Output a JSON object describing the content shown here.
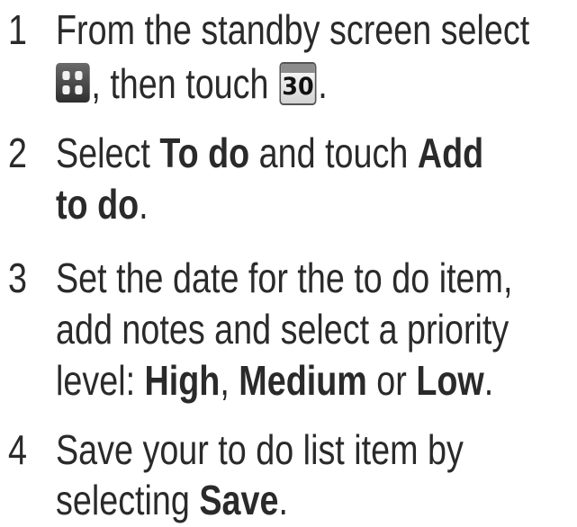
{
  "steps": [
    {
      "number": "1",
      "line1": "From the standby screen select",
      "line2_after_icon": ", then touch",
      "line2_end": ".",
      "icons": [
        "apps-grid-icon",
        "calendar-icon"
      ],
      "calendar_day": "30"
    },
    {
      "number": "2",
      "t1": "Select ",
      "b1": "To do",
      "t2": " and touch ",
      "b2": "Add",
      "b3": "to do",
      "t3": "."
    },
    {
      "number": "3",
      "line1": "Set the date for the to do item,",
      "line2": "add notes and select a priority",
      "t1": "level: ",
      "b1": "High",
      "t2": ", ",
      "b2": "Medium",
      "t3": " or ",
      "b3": "Low",
      "t4": "."
    },
    {
      "number": "4",
      "line1": "Save your to do list item by",
      "t1": "selecting ",
      "b1": "Save",
      "t2": "."
    }
  ]
}
